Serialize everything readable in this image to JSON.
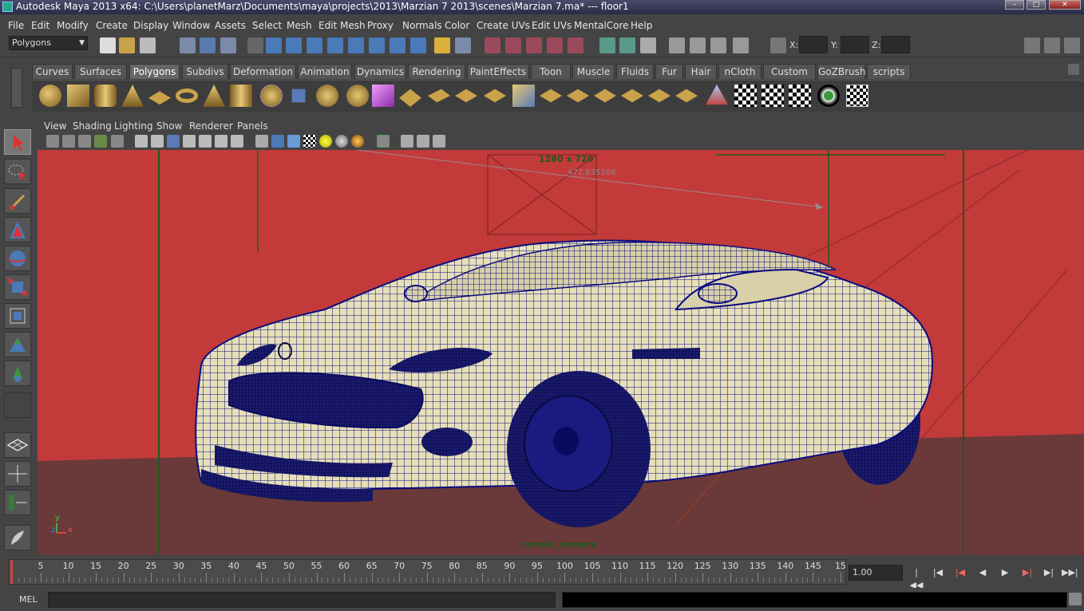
{
  "window": {
    "title": "Autodesk Maya 2013 x64: C:\\Users\\planetMarz\\Documents\\maya\\projects\\2013\\Marzian 7 2013\\scenes\\Marzian 7.ma*   ---   floor1"
  },
  "menu": {
    "items": [
      "File",
      "Edit",
      "Modify",
      "Create",
      "Display",
      "Window",
      "Assets",
      "Select",
      "Mesh",
      "Edit Mesh",
      "Proxy",
      "Normals",
      "Color",
      "Create UVs",
      "Edit UVs",
      "MentalCore",
      "Help"
    ]
  },
  "status_line": {
    "mode": "Polygons",
    "x_label": "X:",
    "y_label": "Y:",
    "z_label": "Z:"
  },
  "shelf": {
    "tabs": [
      "Curves",
      "Surfaces",
      "Polygons",
      "Subdivs",
      "Deformation",
      "Animation",
      "Dynamics",
      "Rendering",
      "PaintEffects",
      "Toon",
      "Muscle",
      "Fluids",
      "Fur",
      "Hair",
      "nCloth",
      "Custom",
      "GoZBrush",
      "scripts"
    ],
    "active_tab": "Polygons"
  },
  "panel": {
    "menus": [
      "View",
      "Shading",
      "Lighting",
      "Show",
      "Renderer",
      "Panels"
    ]
  },
  "viewport": {
    "resolution": "1280 x 720",
    "distance": "472.635266",
    "camera": "render_camera",
    "axis_y": "y",
    "axis_z": "z",
    "axis_x": "x",
    "colors": {
      "background": "#c23a3a",
      "floor": "#6a3a3a",
      "wire": "#0a0a80",
      "car_surface": "#d8d0a8"
    }
  },
  "time_slider": {
    "start": "0",
    "ticks": [
      "5",
      "10",
      "15",
      "20",
      "25",
      "30",
      "35",
      "40",
      "45",
      "50",
      "55",
      "60",
      "65",
      "70",
      "75",
      "80",
      "85",
      "90",
      "95",
      "100",
      "105",
      "110",
      "115",
      "120",
      "125",
      "130",
      "135",
      "140",
      "145",
      "15"
    ],
    "current_frame": "1.00"
  },
  "command_line": {
    "label": "MEL"
  }
}
